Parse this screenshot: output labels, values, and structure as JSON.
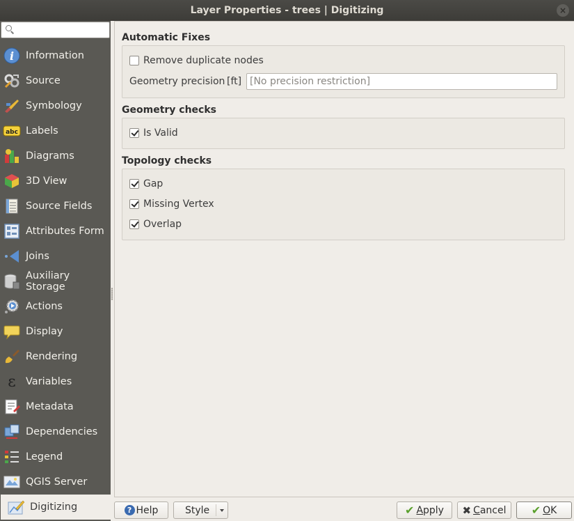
{
  "window": {
    "title": "Layer Properties - trees | Digitizing",
    "close_symbol": "×"
  },
  "sidebar": {
    "search_placeholder": "",
    "items": [
      {
        "label": "Information",
        "icon": "info-icon"
      },
      {
        "label": "Source",
        "icon": "source-icon"
      },
      {
        "label": "Symbology",
        "icon": "symbology-icon"
      },
      {
        "label": "Labels",
        "icon": "labels-icon",
        "icon_text": "abc"
      },
      {
        "label": "Diagrams",
        "icon": "diagrams-icon"
      },
      {
        "label": "3D View",
        "icon": "3d-view-icon"
      },
      {
        "label": "Source Fields",
        "icon": "source-fields-icon"
      },
      {
        "label": "Attributes Form",
        "icon": "attributes-form-icon"
      },
      {
        "label": "Joins",
        "icon": "joins-icon"
      },
      {
        "label": "Auxiliary Storage",
        "icon": "auxiliary-storage-icon"
      },
      {
        "label": "Actions",
        "icon": "actions-icon"
      },
      {
        "label": "Display",
        "icon": "display-icon"
      },
      {
        "label": "Rendering",
        "icon": "rendering-icon"
      },
      {
        "label": "Variables",
        "icon": "variables-icon",
        "icon_text": "ε"
      },
      {
        "label": "Metadata",
        "icon": "metadata-icon"
      },
      {
        "label": "Dependencies",
        "icon": "dependencies-icon"
      },
      {
        "label": "Legend",
        "icon": "legend-icon"
      },
      {
        "label": "QGIS Server",
        "icon": "qgis-server-icon"
      },
      {
        "label": "Digitizing",
        "icon": "digitizing-icon",
        "active": true
      }
    ]
  },
  "automatic_fixes": {
    "title": "Automatic Fixes",
    "remove_duplicate_nodes": {
      "label": "Remove duplicate nodes",
      "checked": false
    },
    "geometry_precision": {
      "label": "Geometry precision",
      "unit": "[ft]",
      "value": "",
      "placeholder": "[No precision restriction]"
    }
  },
  "geometry_checks": {
    "title": "Geometry checks",
    "is_valid": {
      "label": "Is Valid",
      "checked": true
    }
  },
  "topology_checks": {
    "title": "Topology checks",
    "gap": {
      "label": "Gap",
      "checked": true
    },
    "missing_vertex": {
      "label": "Missing Vertex",
      "checked": true
    },
    "overlap": {
      "label": "Overlap",
      "checked": true
    }
  },
  "buttons": {
    "help": {
      "icon_text": "?",
      "label": "Help"
    },
    "style": {
      "label": "Style"
    },
    "apply": {
      "label": "Apply",
      "mnemonic": "A",
      "rest": "pply"
    },
    "cancel": {
      "label": "Cancel",
      "mnemonic": "C",
      "rest": "ancel"
    },
    "ok": {
      "label": "OK",
      "mnemonic": "O",
      "rest": "K"
    }
  },
  "colors": {
    "sidebar_bg": "#5a5954",
    "titlebar_bg": "#3d3c38",
    "content_bg": "#f0ede8",
    "apply_check": "#5aa02c"
  }
}
